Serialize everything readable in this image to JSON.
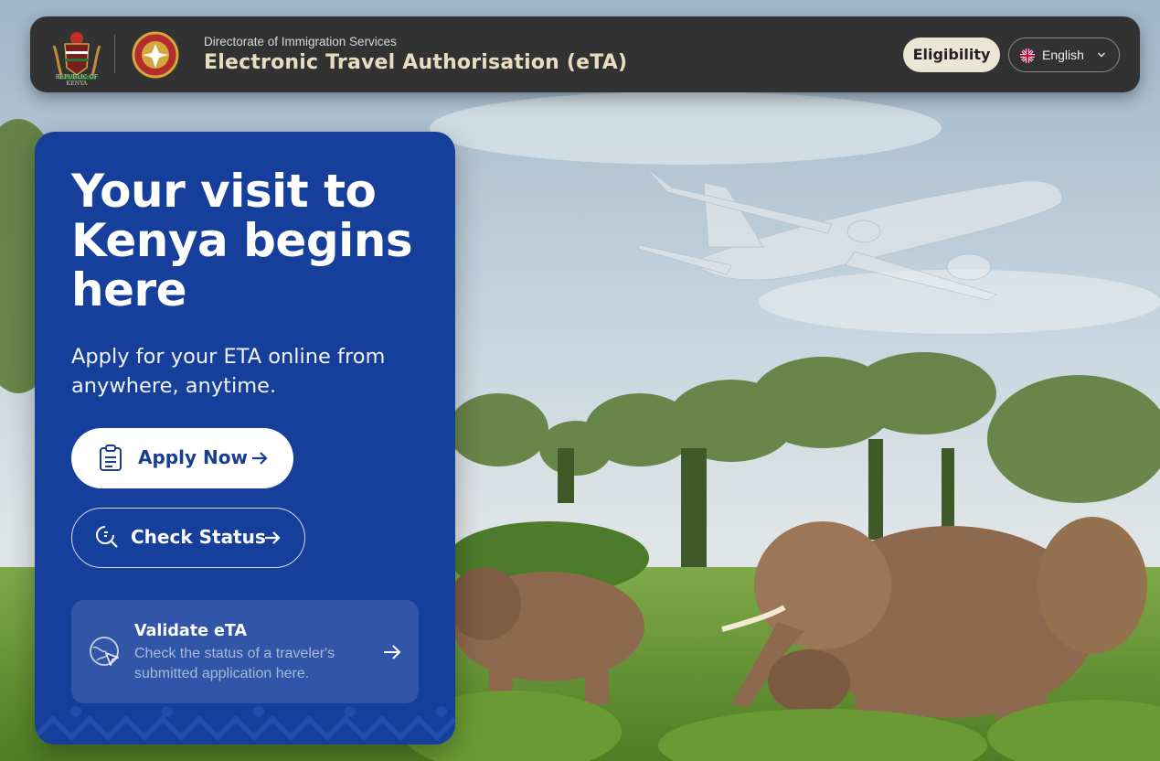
{
  "header": {
    "emblem_caption": "REPUBLIC OF KENYA",
    "subtitle": "Directorate of Immigration Services",
    "title": "Electronic Travel Authorisation (eTA)",
    "eligibility_label": "Eligibility",
    "language": {
      "selected": "English",
      "flag_icon": "uk-flag-icon",
      "chevron_icon": "chevron-down-icon"
    }
  },
  "hero": {
    "title": "Your visit to Kenya begins here",
    "subtitle": "Apply for your ETA online from anywhere, anytime.",
    "apply_button": {
      "label": "Apply Now",
      "icon": "clipboard-icon",
      "arrow_icon": "arrow-right-icon"
    },
    "status_button": {
      "label": "Check Status",
      "icon": "search-status-icon",
      "arrow_icon": "arrow-right-icon"
    },
    "validate_card": {
      "title": "Validate eTA",
      "description": "Check the status of a traveler's submitted application here.",
      "icon": "globe-cursor-icon",
      "arrow_icon": "arrow-right-icon"
    }
  },
  "colors": {
    "header_bg": "#333232",
    "header_title": "#e8ddc1",
    "card_bg": "#163f9b",
    "button_text": "#173e8f",
    "eligibility_bg": "#ece6d6"
  }
}
